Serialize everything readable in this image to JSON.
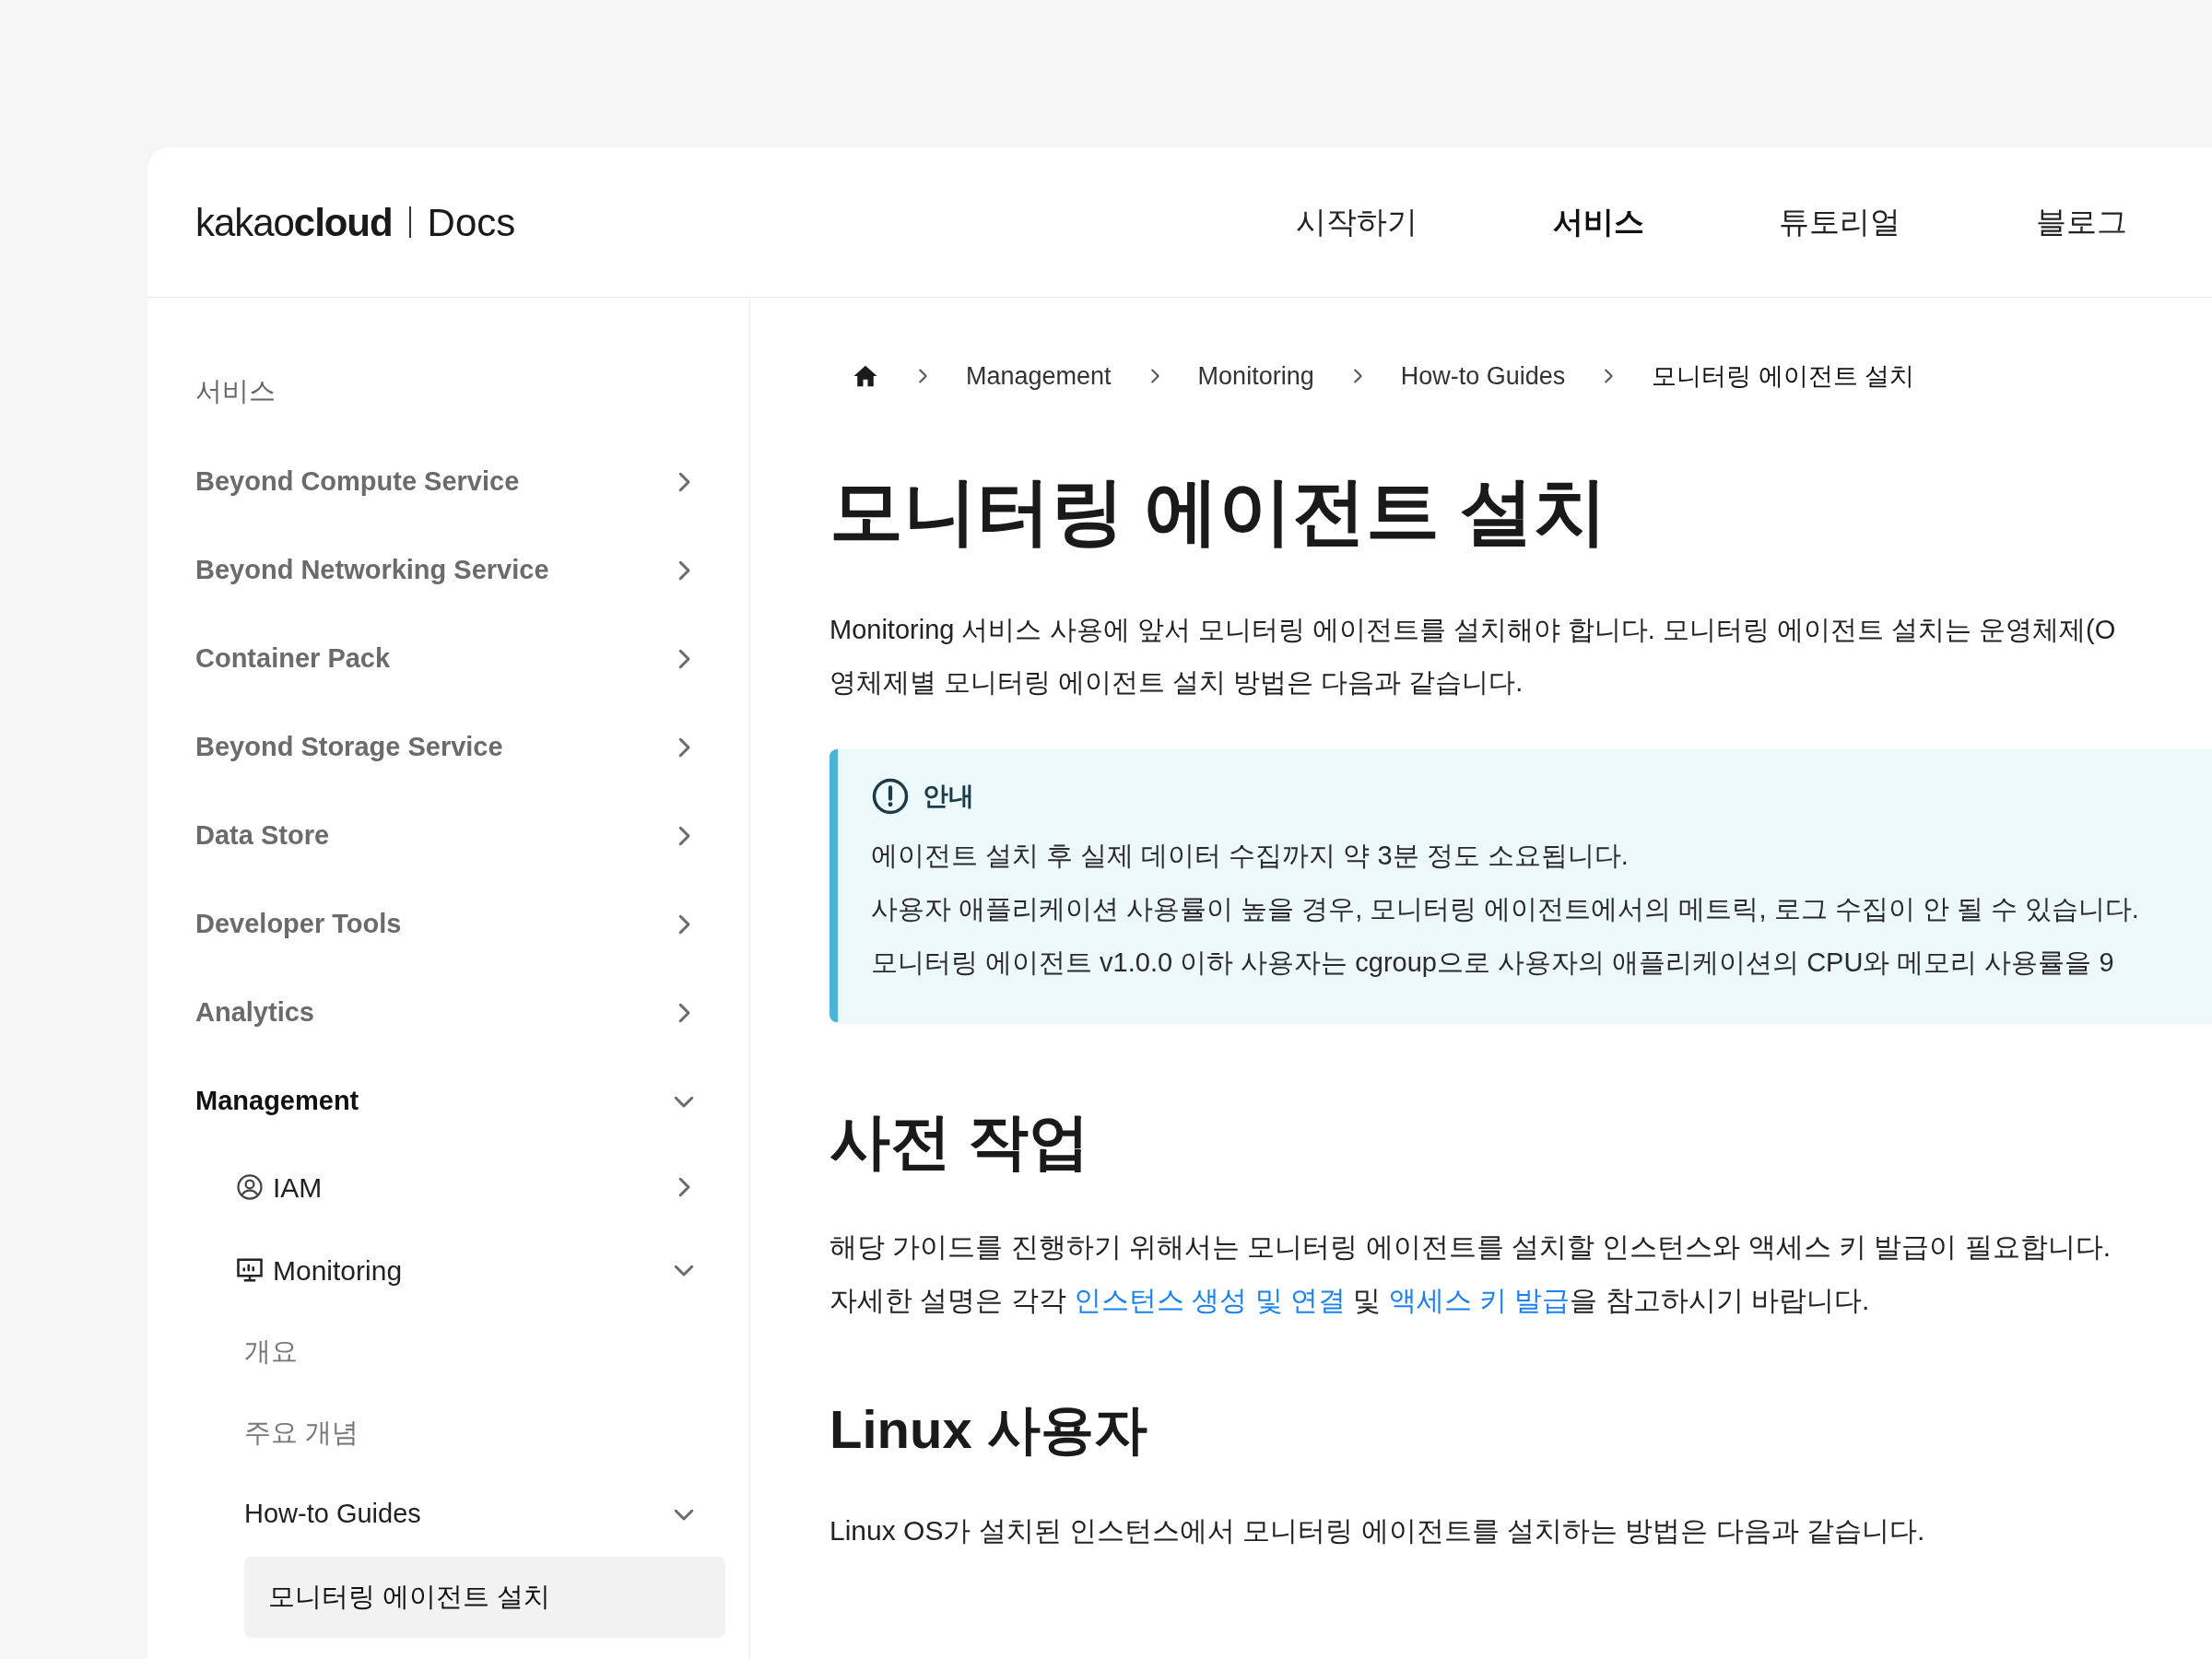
{
  "header": {
    "logo": "kakao**cloud**",
    "logo_suffix": "Docs",
    "nav": [
      {
        "label": "시작하기",
        "selected": false
      },
      {
        "label": "서비스",
        "selected": true
      },
      {
        "label": "튜토리얼",
        "selected": false
      },
      {
        "label": "블로그",
        "selected": false
      }
    ]
  },
  "sidebar": {
    "heading": "서비스",
    "items": [
      {
        "label": "Beyond Compute Service",
        "expanded": false
      },
      {
        "label": "Beyond Networking Service",
        "expanded": false
      },
      {
        "label": "Container Pack",
        "expanded": false
      },
      {
        "label": "Beyond Storage Service",
        "expanded": false
      },
      {
        "label": "Data Store",
        "expanded": false
      },
      {
        "label": "Developer Tools",
        "expanded": false
      },
      {
        "label": "Analytics",
        "expanded": false
      },
      {
        "label": "Management",
        "expanded": true,
        "children": [
          {
            "label": "IAM",
            "expanded": false
          },
          {
            "label": "Monitoring",
            "expanded": true,
            "children": [
              {
                "label": "개요",
                "selected": false
              },
              {
                "label": "주요 개념",
                "selected": false
              },
              {
                "label": "How-to Guides",
                "expanded": true,
                "children": [
                  {
                    "label": "모니터링 에이전트 설치",
                    "selected": true
                  }
                ]
              }
            ]
          }
        ]
      }
    ]
  },
  "breadcrumb": [
    "Management",
    "Monitoring",
    "How-to Guides",
    "모니터링 에이전트 설치"
  ],
  "title": "모니터링 에이전트 설치",
  "intro": [
    "Monitoring 서비스 사용에 앞서 모니터링 에이전트를 설치해야 합니다. 모니터링 에이전트 설치는 운영체제(O",
    "영체제별 모니터링 에이전트 설치 방법은 다음과 같습니다."
  ],
  "notice": {
    "title": "안내",
    "lines": [
      "에이전트 설치 후 실제 데이터 수집까지 약 3분 정도 소요됩니다.",
      "사용자 애플리케이션 사용률이 높을 경우, 모니터링 에이전트에서의 메트릭, 로그 수집이 안 될 수 있습니다.",
      "모니터링 에이전트 v1.0.0 이하 사용자는 cgroup으로 사용자의 애플리케이션의 CPU와 메모리 사용률을 9"
    ]
  },
  "sections": [
    {
      "heading": "사전 작업",
      "paragraph": [
        [
          {
            "text": "해당 가이드를 진행하기 위해서는 모니터링 에이전트를 설치할 인스턴스와 액세스 키 발급이 필요합니다."
          }
        ],
        [
          {
            "text": "자세한 설명은 각각 "
          },
          {
            "text": "인스턴스 생성 및 연결",
            "link": true
          },
          {
            "text": " 및 "
          },
          {
            "text": "액세스 키 발급",
            "link": true
          },
          {
            "text": "을 참고하시기 바랍니다."
          }
        ]
      ]
    },
    {
      "heading": "Linux 사용자",
      "paragraph": [
        [
          {
            "text": "Linux OS가 설치된 인스턴스에서 모니터링 에이전트를 설치하는 방법은 다음과 같습니다."
          }
        ]
      ]
    }
  ]
}
